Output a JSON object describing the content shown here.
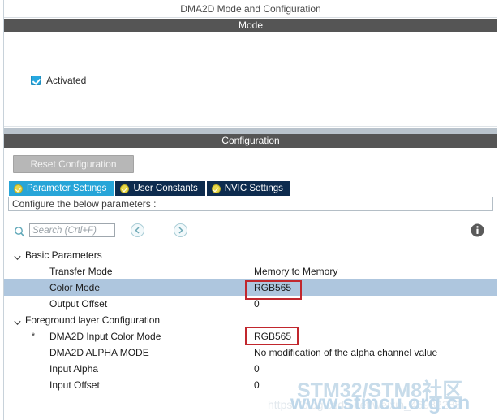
{
  "window": {
    "title": "DMA2D Mode and Configuration"
  },
  "mode_section": {
    "header": "Mode",
    "checkbox": {
      "label": "Activated",
      "checked": true,
      "icon": "checkbox-checked-icon",
      "color": "#27a8e0"
    }
  },
  "configuration_section": {
    "header": "Configuration",
    "reset_button": "Reset Configuration",
    "tabs": [
      {
        "label": "Parameter Settings",
        "active": true,
        "icon": "check-circle-icon"
      },
      {
        "label": "User Constants",
        "active": false,
        "icon": "check-circle-icon"
      },
      {
        "label": "NVIC Settings",
        "active": false,
        "icon": "check-circle-icon"
      }
    ],
    "tab_colors": {
      "active": "#27a5d8",
      "inactive": "#0d2b4e"
    },
    "configure_hint": "Configure the below parameters :",
    "search": {
      "placeholder": "Search (Crtl+F)",
      "value": "",
      "icon": "search-icon",
      "prev_icon": "chevron-left-circle-icon",
      "next_icon": "chevron-right-circle-icon"
    },
    "info_icon": "info-icon",
    "tree": [
      {
        "type": "group",
        "label": "Basic Parameters",
        "expanded": true,
        "icon": "chevron-down-icon"
      },
      {
        "type": "param",
        "label": "Transfer Mode",
        "value": "Memory to Memory",
        "selected": false,
        "required": false
      },
      {
        "type": "param",
        "label": "Color Mode",
        "value": "RGB565",
        "selected": true,
        "required": false,
        "highlight": "#aec6de"
      },
      {
        "type": "param",
        "label": "Output Offset",
        "value": "0",
        "selected": false,
        "required": false
      },
      {
        "type": "group",
        "label": "Foreground layer Configuration",
        "expanded": true,
        "icon": "chevron-down-icon"
      },
      {
        "type": "param",
        "label": "DMA2D Input Color Mode",
        "value": "RGB565",
        "selected": false,
        "required": true,
        "required_marker": "*"
      },
      {
        "type": "param",
        "label": "DMA2D ALPHA MODE",
        "value": "No modification of the alpha channel value",
        "selected": false,
        "required": false
      },
      {
        "type": "param",
        "label": "Input Alpha",
        "value": "0",
        "selected": false,
        "required": false
      },
      {
        "type": "param",
        "label": "Input Offset",
        "value": "0",
        "selected": false,
        "required": false
      }
    ]
  },
  "annotations": {
    "color": "#c1272d",
    "boxes": [
      {
        "target": "Color Mode value",
        "text": "RGB565"
      },
      {
        "target": "DMA2D Input Color Mode value",
        "text": "RGB565"
      }
    ]
  },
  "watermark": {
    "line1": "STM32/STM8社区",
    "line2": "www.stmcu.org.cn",
    "faint_url": "https://blog.csdn.net/weixin_46932288",
    "color": "#c8dcea"
  }
}
